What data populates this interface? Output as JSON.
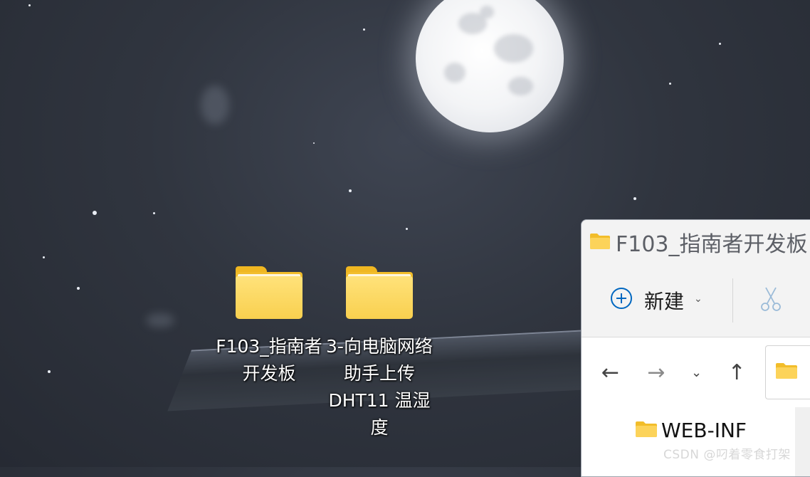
{
  "desktop": {
    "icons": [
      {
        "label": "F103_指南者开发板"
      },
      {
        "label": "3-向电脑网络助手上传DHT11 温湿度"
      }
    ]
  },
  "explorer": {
    "title": "F103_指南者开发板",
    "toolbar": {
      "new_label": "新建"
    },
    "content_items": [
      {
        "label": "WEB-INF"
      }
    ]
  },
  "watermark": "CSDN @叼着零食打架",
  "colors": {
    "folder_yellow": "#F9D04F",
    "accent_blue": "#0067C0"
  }
}
